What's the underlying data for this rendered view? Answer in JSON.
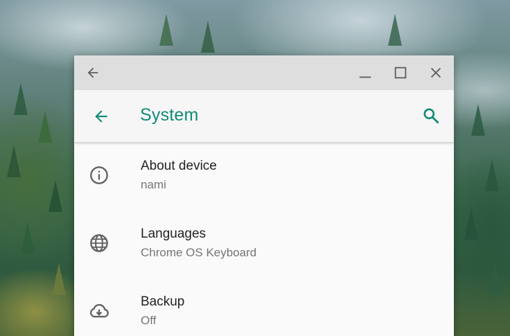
{
  "window": {
    "app_bar": {
      "title": "System",
      "accent_color": "#0f8b74"
    },
    "titlebar_icons": [
      "back-arrow-icon",
      "minimize-icon",
      "maximize-icon",
      "close-icon"
    ],
    "items": [
      {
        "title": "About device",
        "subtitle": "nami",
        "icon": "info-icon"
      },
      {
        "title": "Languages",
        "subtitle": "Chrome OS Keyboard",
        "icon": "globe-icon"
      },
      {
        "title": "Backup",
        "subtitle": "Off",
        "icon": "cloud-download-icon"
      }
    ]
  }
}
